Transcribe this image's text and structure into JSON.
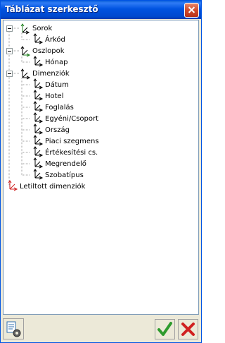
{
  "window": {
    "title": "Táblázat szerkesztő"
  },
  "tree": {
    "sorok": {
      "label": "Sorok",
      "children": [
        "Árkód"
      ]
    },
    "oszlopok": {
      "label": "Oszlopok",
      "children": [
        "Hónap"
      ]
    },
    "dimenziok": {
      "label": "Dimenziók",
      "children": [
        "Dátum",
        "Hotel",
        "Foglalás",
        "Egyéni/Csoport",
        "Ország",
        "Piaci szegmens",
        "Értékesítési cs.",
        "Megrendelő",
        "Szobatípus"
      ]
    },
    "letiltott": {
      "label": "Letiltott dimenziók"
    }
  },
  "buttons": {
    "settings_icon": "settings-icon",
    "ok_icon": "checkmark-icon",
    "cancel_icon": "x-icon"
  },
  "colors": {
    "ok": "#2e9b2e",
    "cancel": "#d02020",
    "titlebar": "#0053e0"
  }
}
